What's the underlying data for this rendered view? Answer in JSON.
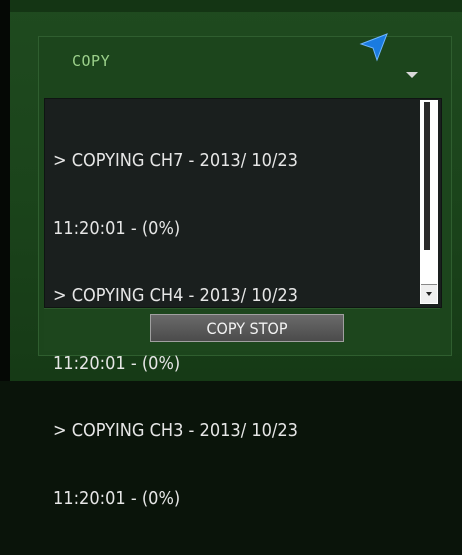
{
  "dialog": {
    "title": "COPY"
  },
  "log": {
    "lines": [
      "> COPYING CH7 - 2013/ 10/23",
      "11:20:01 - (0%)",
      "> COPYING CH4 - 2013/ 10/23",
      "11:20:01 - (0%)",
      "> COPYING CH3 - 2013/ 10/23",
      "11:20:01 - (0%)"
    ]
  },
  "buttons": {
    "copy_stop_label": "COPY STOP"
  },
  "icons": {
    "cursor": "cursor-arrow-icon",
    "dropdown": "chevron-down-icon",
    "scroll_down": "scroll-down-icon"
  },
  "colors": {
    "panel_green": "#1c451c",
    "title_green": "#9bd08a",
    "cursor_blue": "#1a7be0",
    "log_background": "#1a1f1e"
  }
}
